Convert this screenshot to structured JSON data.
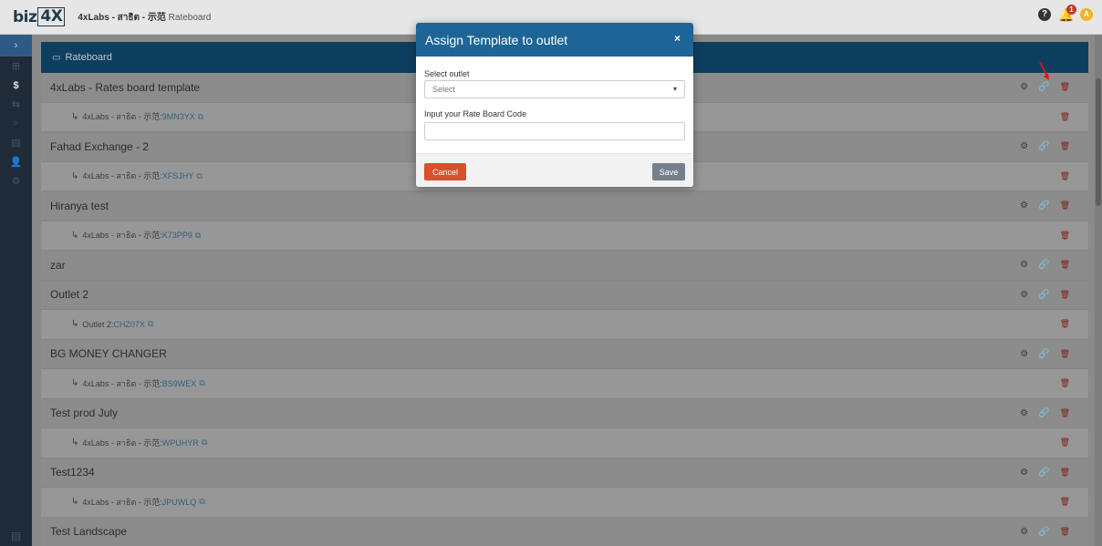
{
  "topbar": {
    "logo_prefix": "biz",
    "logo_box": "4X",
    "breadcrumb_bold": "4xLabs - สาธิต - 示范",
    "breadcrumb_page": "Rateboard",
    "notification_count": "1",
    "avatar_initial": "A"
  },
  "sidebar": {
    "toggle_icon": "›",
    "items": [
      "⊞",
      "$",
      "⇆",
      "⌕",
      "▤",
      "👤",
      "⚙"
    ],
    "bottom_icon": "▤"
  },
  "panel": {
    "icon": "▭",
    "title": "Rateboard"
  },
  "rows": [
    {
      "type": "parent",
      "name": "4xLabs - Rates board template"
    },
    {
      "type": "child",
      "prefix": "4xLabs - สาธิต - 示范:",
      "code": "9MN3YX"
    },
    {
      "type": "parent",
      "name": "Fahad Exchange - 2"
    },
    {
      "type": "child",
      "prefix": "4xLabs - สาธิต - 示范:",
      "code": "XFSJHY"
    },
    {
      "type": "parent",
      "name": "Hiranya test"
    },
    {
      "type": "child",
      "prefix": "4xLabs - สาธิต - 示范:",
      "code": "K73PP9"
    },
    {
      "type": "parent",
      "name": "zar"
    },
    {
      "type": "parent",
      "name": "Outlet 2"
    },
    {
      "type": "child",
      "prefix": "Outlet 2:",
      "code": "CHZ07X"
    },
    {
      "type": "parent",
      "name": "BG MONEY CHANGER"
    },
    {
      "type": "child",
      "prefix": "4xLabs - สาธิต - 示范:",
      "code": "BS9WEX"
    },
    {
      "type": "parent",
      "name": "Test prod July"
    },
    {
      "type": "child",
      "prefix": "4xLabs - สาธิต - 示范:",
      "code": "WPUHYR"
    },
    {
      "type": "parent",
      "name": "Test1234"
    },
    {
      "type": "child",
      "prefix": "4xLabs - สาธิต - 示范:",
      "code": "JPUWLQ"
    },
    {
      "type": "parent",
      "name": "Test Landscape"
    }
  ],
  "icons": {
    "settings": "gears-icon",
    "link": "link-icon",
    "delete": "trash-icon"
  },
  "modal": {
    "title": "Assign Template to outlet",
    "close": "×",
    "outlet_label": "Select outlet",
    "outlet_value": "Select",
    "code_label": "Input your Rate Board Code",
    "code_value": "",
    "cancel_label": "Cancel",
    "save_label": "Save"
  },
  "colors": {
    "modal_header": "#1d6597",
    "panel_header": "#0f3f5e",
    "cancel": "#d9502d",
    "save": "#75808c",
    "sidebar": "#1f2b38"
  }
}
